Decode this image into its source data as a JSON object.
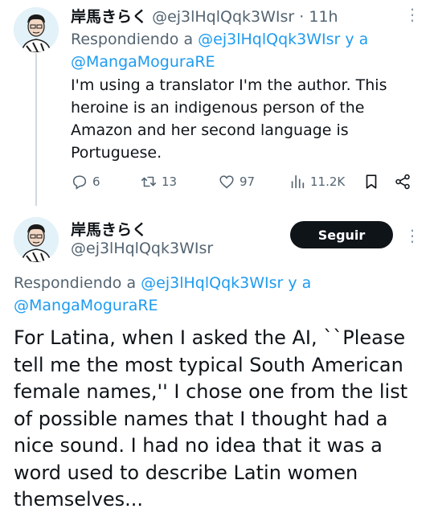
{
  "tweet1": {
    "author_name": "岸馬きらく",
    "handle": "@ej3lHqlQqk3WIsr",
    "separator": "·",
    "time": "11h",
    "reply_prefix": "Respondiendo a",
    "reply_to_1": "@ej3lHqlQqk3WIsr",
    "reply_and": "y a",
    "reply_to_2": "@MangaMoguraRE",
    "body": "I'm using a translator I'm the author. This heroine is an indigenous person of the Amazon and her second language is Portuguese.",
    "stats": {
      "replies": "6",
      "retweets": "13",
      "likes": "97",
      "views": "11.2K"
    }
  },
  "tweet2": {
    "author_name": "岸馬きらく",
    "handle": "@ej3lHqlQqk3WIsr",
    "follow_label": "Seguir",
    "reply_prefix": "Respondiendo a",
    "reply_to_1": "@ej3lHqlQqk3WIsr",
    "reply_and": "y a",
    "reply_to_2": "@MangaMoguraRE",
    "body": "For Latina, when I asked the AI, ``Please tell me the most typical South American female names,'' I chose one from the list of possible names that I thought had a nice sound. I had no idea that it was a word used to describe Latin women themselves..."
  },
  "icons": [
    "reply-icon",
    "retweet-icon",
    "like-icon",
    "views-icon",
    "bookmark-icon",
    "share-icon",
    "more-icon"
  ],
  "colors": {
    "link": "#1d9bf0",
    "muted": "#536471",
    "text": "#0f1419",
    "button_bg": "#0f1419",
    "thread_line": "#cfd9de"
  }
}
